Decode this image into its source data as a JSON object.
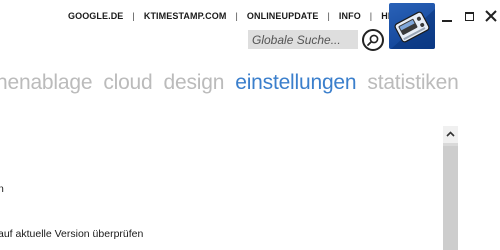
{
  "header": {
    "links": [
      {
        "label": "GOOGLE.DE"
      },
      {
        "label": "KTIMESTAMP.COM"
      },
      {
        "label": "ONLINEUPDATE"
      },
      {
        "label": "INFO"
      },
      {
        "label": "HILFE"
      }
    ],
    "separator": "|",
    "search": {
      "placeholder": "Globale Suche...",
      "value": ""
    }
  },
  "nav": {
    "tabs": [
      {
        "label": "nenablage"
      },
      {
        "label": "cloud"
      },
      {
        "label": "design"
      },
      {
        "label": "einstellungen",
        "active": true
      },
      {
        "label": "statistiken"
      }
    ],
    "active_color": "#3b7fcc",
    "inactive_color": "#bbbbbb"
  },
  "content": {
    "line1": "n",
    "line2": "auf aktuelle Version überprüfen"
  },
  "colors": {
    "logo_bg": "#1d4fa3",
    "scrollbar_track": "#d9d9d9"
  }
}
